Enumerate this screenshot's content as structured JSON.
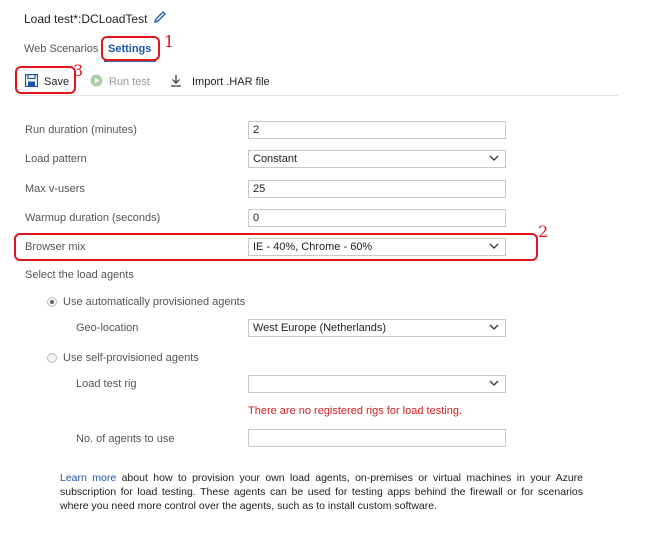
{
  "header": {
    "title": "Load test*:DCLoadTest"
  },
  "tabs": [
    {
      "label": "Web Scenarios"
    },
    {
      "label": "Settings"
    }
  ],
  "toolbar": {
    "save_label": "Save",
    "run_label": "Run test",
    "import_label": "Import .HAR file"
  },
  "form": {
    "run_duration": {
      "label": "Run duration (minutes)",
      "value": "2"
    },
    "load_pattern": {
      "label": "Load pattern",
      "value": "Constant"
    },
    "max_vusers": {
      "label": "Max v-users",
      "value": "25"
    },
    "warmup_duration": {
      "label": "Warmup duration (seconds)",
      "value": "0"
    },
    "browser_mix": {
      "label": "Browser mix",
      "value": "IE - 40%, Chrome - 60%"
    }
  },
  "agents": {
    "section_label": "Select the load agents",
    "auto_label": "Use automatically provisioned agents",
    "geo_label": "Geo-location",
    "geo_value": "West Europe (Netherlands)",
    "self_label": "Use self-provisioned agents",
    "rig_label": "Load test rig",
    "rig_value": "",
    "rig_error": "There are no registered rigs for load testing.",
    "num_agents_label": "No. of agents to use",
    "num_agents_value": ""
  },
  "info": {
    "link_text": "Learn more",
    "text": " about how to provision your own load agents, on-premises or virtual machines in your Azure subscription for load testing. These agents can be used for testing apps behind the firewall or for scenarios where you need more control over the agents, such as to install custom software."
  },
  "annotations": {
    "n1": "1",
    "n2": "2",
    "n3": "3"
  }
}
